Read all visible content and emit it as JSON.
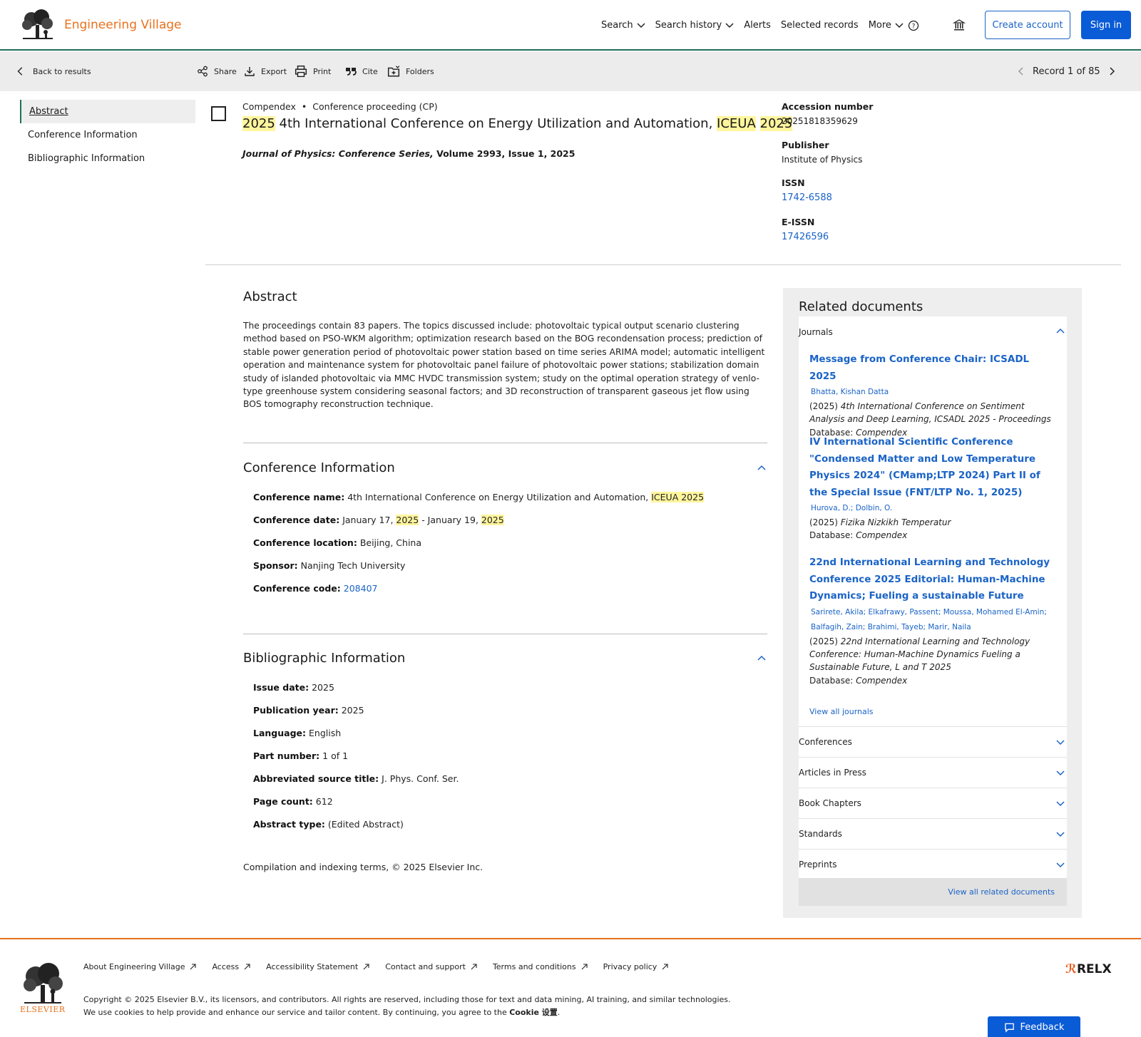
{
  "header": {
    "brand": "Engineering Village",
    "nav": [
      "Search",
      "Search history",
      "Alerts",
      "Selected records",
      "More"
    ],
    "create_account": "Create account",
    "sign_in": "Sign in"
  },
  "toolbar": {
    "back": "Back to results",
    "share": "Share",
    "export": "Export",
    "print": "Print",
    "cite": "Cite",
    "folders": "Folders",
    "record": "Record 1 of 85"
  },
  "sidebar": {
    "items": [
      "Abstract",
      "Conference Information",
      "Bibliographic Information"
    ]
  },
  "record": {
    "database": "Compendex",
    "doc_type": "Conference proceeding (CP)",
    "title_parts": [
      "2025",
      " 4th International Conference on Energy Utilization and Automation, ",
      "ICEUA",
      " ",
      "2025"
    ],
    "source_journal": "Journal of Physics: Conference Series,",
    "source_rest": " Volume 2993, Issue 1, 2025"
  },
  "record_meta": [
    {
      "label": "Accession number",
      "value": "20251818359629"
    },
    {
      "label": "Publisher",
      "value": "Institute of Physics"
    },
    {
      "label": "ISSN",
      "value": "1742-6588"
    },
    {
      "label": "E-ISSN",
      "value": "17426596"
    }
  ],
  "abstract": {
    "heading": "Abstract",
    "text": "The proceedings contain 83 papers. The topics discussed include: photovoltaic typical output scenario clustering method based on PSO-WKM algorithm; optimization research based on the BOG recondensation process; prediction of stable power generation period of photovoltaic power station based on time series ARIMA model; automatic intelligent operation and maintenance system for photovoltaic panel failure of photovoltaic power stations; stabilization domain study of islanded photovoltaic via MMC HVDC transmission system; study on the optimal operation strategy of venlo-type greenhouse system considering seasonal factors; and 3D reconstruction of transparent gaseous jet flow using BOS tomography reconstruction technique."
  },
  "conference": {
    "heading": "Conference Information",
    "name_label": "Conference name:",
    "name_value": "4th International Conference on Energy Utilization and Automation, ",
    "name_hl": "ICEUA 2025",
    "date_label": "Conference date:",
    "date_a": "January 17, ",
    "date_y1": "2025",
    "date_b": " - January 19, ",
    "date_y2": "2025",
    "location_label": "Conference location:",
    "location_value": "Beijing, China",
    "sponsor_label": "Sponsor:",
    "sponsor_value": "Nanjing Tech University",
    "code_label": "Conference code:",
    "code_value": "208407"
  },
  "bibliographic": {
    "heading": "Bibliographic Information",
    "fields": [
      {
        "label": "Issue date:",
        "value": "2025"
      },
      {
        "label": "Publication year:",
        "value": "2025"
      },
      {
        "label": "Language:",
        "value": "English"
      },
      {
        "label": "Part number:",
        "value": "1 of 1"
      },
      {
        "label": "Abbreviated source title:",
        "value": "J. Phys. Conf. Ser."
      },
      {
        "label": "Page count:",
        "value": "612"
      },
      {
        "label": "Abstract type:",
        "value": "(Edited Abstract)"
      }
    ]
  },
  "copyright_line": "Compilation and indexing terms, © 2025 Elsevier Inc.",
  "related": {
    "heading": "Related documents",
    "journals_label": "Journals",
    "docs": [
      {
        "title": "Message from Conference Chair: ICSADL 2025",
        "authors": [
          "Bhatta, Kishan Datta"
        ],
        "source_year": "(2025) ",
        "source": "4th International Conference on Sentiment Analysis and Deep Learning, ICSADL 2025 - Proceedings",
        "db_label": "Database: ",
        "db": "Compendex"
      },
      {
        "title": "IV International Scientific Conference \"Condensed Matter and Low Temperature Physics 2024\" (CMamp;LTP 2024) Part II of the Special Issue (FNT/LTP No. 1, 2025)",
        "authors": [
          "Hurova, D.;",
          "Dolbin, O."
        ],
        "source_year": "(2025) ",
        "source": "Fizika Nizkikh Temperatur",
        "db_label": "Database: ",
        "db": "Compendex"
      },
      {
        "title": "22nd International Learning and Technology Conference 2025 Editorial: Human-Machine Dynamics; Fueling a sustainable Future",
        "authors": [
          "Sarirete, Akila;",
          "Elkafrawy, Passent;",
          "Moussa, Mohamed El-Amin;",
          "Balfagih, Zain;",
          "Brahimi, Tayeb;",
          "Marir, Naila"
        ],
        "source_year": "(2025) ",
        "source": "22nd International Learning and Technology Conference: Human-Machine Dynamics Fueling a Sustainable Future, L and T 2025",
        "db_label": "Database: ",
        "db": "Compendex"
      }
    ],
    "view_all_journals": "View all journals",
    "categories": [
      "Conferences",
      "Articles in Press",
      "Book Chapters",
      "Standards",
      "Preprints"
    ],
    "view_all_related": "View all related documents"
  },
  "footer": {
    "logo_text": "ELSEVIER",
    "links": [
      "About Engineering Village",
      "Access",
      "Accessibility Statement",
      "Contact and support",
      "Terms and conditions",
      "Privacy policy"
    ],
    "copyright": "Copyright © 2025 Elsevier B.V., its licensors, and contributors. All rights are reserved, including those for text and data mining, AI training, and similar technologies.",
    "cookie_text": "We use cookies to help provide and enhance our service and tailor content. By continuing, you agree to the ",
    "cookie_link": "Cookie 设置",
    "relx": "RELX",
    "feedback": "Feedback"
  },
  "colors": {
    "brand_orange": "#e9711c",
    "link_blue": "#1a63c7",
    "primary_button": "#0a5bd6",
    "header_rule": "#1f6f59",
    "highlight": "#fff59d"
  }
}
